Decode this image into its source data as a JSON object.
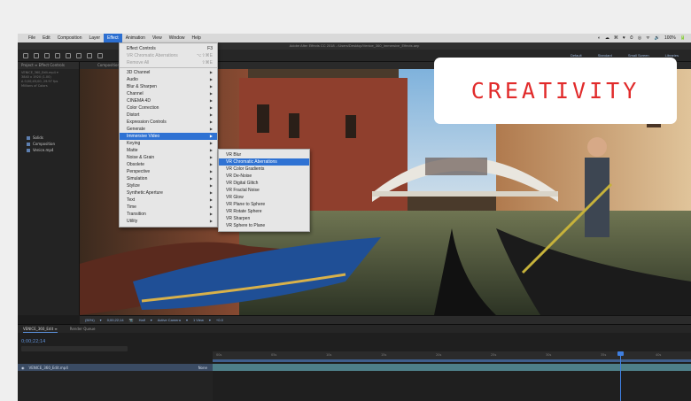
{
  "menubar": {
    "items": [
      "File",
      "Edit",
      "Composition",
      "Layer",
      "Effect",
      "Animation",
      "View",
      "Window",
      "Help"
    ],
    "active": "Effect",
    "tray": [
      "◐",
      "☁",
      "⌘",
      "♥",
      "⏱",
      "◎",
      "ᯤ",
      "🔊",
      "100%",
      "🔋"
    ]
  },
  "app_title": "Adobe After Effects CC 2018 - /Users/Desktop/Venice_360_Immersive_Effects.aep",
  "toolbar": {
    "workspaces": [
      "Default",
      "Standard",
      "Small Screen",
      "Libraries"
    ]
  },
  "project_panel": {
    "tab": "Project ≡  Effect Controls",
    "meta": [
      "VENICE_360_Edit.mp4 ▾",
      "3840 x 1920 (1.00)",
      "Δ 0;00;45;00, 29.97 fps",
      "Millions of Colors"
    ],
    "items": [
      {
        "name": "Solids"
      },
      {
        "name": "Composition"
      },
      {
        "name": "Venice.mp4"
      }
    ]
  },
  "viewer": {
    "tab": "Composition  VENICE_360_Edit ≡",
    "footer": [
      "(50%)",
      "▾",
      "0;00;22;14",
      "📷",
      "Half",
      "▾",
      "Active Camera",
      "▾",
      "1 View",
      "▾",
      "+0.0"
    ]
  },
  "effect_menu": {
    "items": [
      {
        "label": "Effect Controls",
        "shortcut": "F3",
        "dim": false,
        "submenu": false
      },
      {
        "label": "VR Chromatic Aberrations",
        "shortcut": "⌥⇧⌘E",
        "dim": true,
        "submenu": false
      },
      {
        "label": "Remove All",
        "shortcut": "⇧⌘E",
        "dim": true,
        "submenu": false
      },
      {
        "sep": true
      },
      {
        "label": "3D Channel",
        "submenu": true
      },
      {
        "label": "Audio",
        "submenu": true
      },
      {
        "label": "Blur & Sharpen",
        "submenu": true
      },
      {
        "label": "Channel",
        "submenu": true
      },
      {
        "label": "CINEMA 4D",
        "submenu": true
      },
      {
        "label": "Color Correction",
        "submenu": true
      },
      {
        "label": "Distort",
        "submenu": true
      },
      {
        "label": "Expression Controls",
        "submenu": true
      },
      {
        "label": "Generate",
        "submenu": true
      },
      {
        "label": "Immersive Video",
        "submenu": true,
        "selected": true
      },
      {
        "label": "Keying",
        "submenu": true
      },
      {
        "label": "Matte",
        "submenu": true
      },
      {
        "label": "Noise & Grain",
        "submenu": true
      },
      {
        "label": "Obsolete",
        "submenu": true
      },
      {
        "label": "Perspective",
        "submenu": true
      },
      {
        "label": "Simulation",
        "submenu": true
      },
      {
        "label": "Stylize",
        "submenu": true
      },
      {
        "label": "Synthetic Aperture",
        "submenu": true
      },
      {
        "label": "Text",
        "submenu": true
      },
      {
        "label": "Time",
        "submenu": true
      },
      {
        "label": "Transition",
        "submenu": true
      },
      {
        "label": "Utility",
        "submenu": true
      }
    ]
  },
  "immersive_menu": {
    "items": [
      {
        "label": "VR Blur"
      },
      {
        "label": "VR Chromatic Aberrations",
        "selected": true
      },
      {
        "label": "VR Color Gradients"
      },
      {
        "label": "VR De-Noise"
      },
      {
        "label": "VR Digital Glitch"
      },
      {
        "label": "VR Fractal Noise"
      },
      {
        "label": "VR Glow"
      },
      {
        "label": "VR Plane to Sphere"
      },
      {
        "label": "VR Rotate Sphere"
      },
      {
        "label": "VR Sharpen"
      },
      {
        "label": "VR Sphere to Plane"
      }
    ]
  },
  "timeline": {
    "tabs": [
      "VENICE_360_Edit ≡",
      "Render Queue"
    ],
    "timecode": "0;00;22;14",
    "layer_name": "VENICE_360_Edit.mp4",
    "layer_mode": "None",
    "ruler_ticks": [
      "00s",
      "05s",
      "10s",
      "15s",
      "20s",
      "25s",
      "30s",
      "35s",
      "40s"
    ]
  },
  "badge": {
    "text": "CREATIVITY"
  },
  "colors": {
    "menu_highlight": "#2f72d3",
    "badge_text": "#e12b2b",
    "track": "#4e7f89"
  }
}
